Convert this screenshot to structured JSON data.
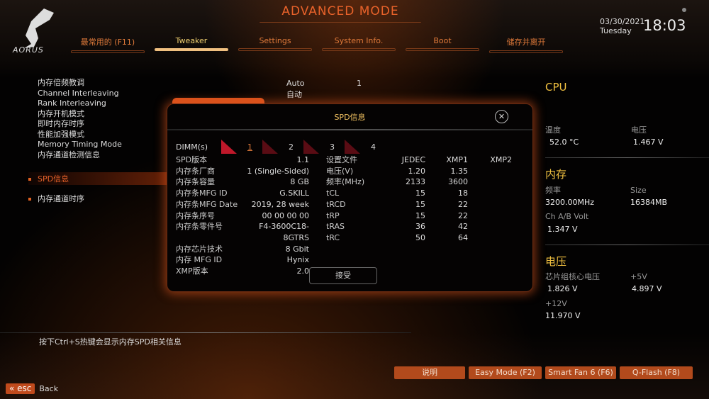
{
  "header": {
    "title": "ADVANCED MODE",
    "logo": "AORUS",
    "date": "03/30/2021",
    "day": "Tuesday",
    "time": "18:03"
  },
  "tabs": [
    {
      "label": "最常用的 (F11)"
    },
    {
      "label": "Tweaker",
      "active": true
    },
    {
      "label": "Settings"
    },
    {
      "label": "System Info."
    },
    {
      "label": "Boot"
    },
    {
      "label": "储存并离开"
    }
  ],
  "menu": {
    "items": [
      "内存倍频教调",
      "Channel Interleaving",
      "Rank Interleaving",
      "内存开机模式",
      "即时内存时序",
      "性能加强模式",
      "Memory Timing Mode",
      "内存通道检测信息"
    ],
    "values": [
      "Auto",
      "1",
      "自动"
    ],
    "sub_items": [
      {
        "label": "SPD信息",
        "selected": true
      },
      {
        "label": "内存通道时序"
      }
    ]
  },
  "modal": {
    "title": "SPD信息",
    "accept_label": "接受",
    "dimm_label": "DIMM(s)",
    "dimms": [
      "1",
      "2",
      "3",
      "4"
    ],
    "selected_dimm": "1",
    "info": [
      [
        "SPD版本",
        "1.1"
      ],
      [
        "内存条厂商",
        "1 (Single-Sided)"
      ],
      [
        "内存条容量",
        "8 GB"
      ],
      [
        "内存条MFG ID",
        "G.SKILL"
      ],
      [
        "内存条MFG Date",
        "2019, 28 week"
      ],
      [
        "内存条序号",
        "00 00 00 00"
      ],
      [
        "内存条零件号",
        "F4-3600C18-8GTRS"
      ],
      [
        "内存芯片技术",
        "8 Gbit"
      ],
      [
        "内存 MFG ID",
        "Hynix"
      ],
      [
        "XMP版本",
        "2.0"
      ]
    ],
    "timing_headers": [
      "设置文件",
      "JEDEC",
      "XMP1",
      "XMP2"
    ],
    "timings": [
      [
        "电压(V)",
        "1.20",
        "1.35",
        ""
      ],
      [
        "频率(MHz)",
        "2133",
        "3600",
        ""
      ],
      [
        "tCL",
        "15",
        "18",
        ""
      ],
      [
        "tRCD",
        "15",
        "22",
        ""
      ],
      [
        "tRP",
        "15",
        "22",
        ""
      ],
      [
        "tRAS",
        "36",
        "42",
        ""
      ],
      [
        "tRC",
        "50",
        "64",
        ""
      ]
    ]
  },
  "right_panel": {
    "cpu": {
      "title": "CPU",
      "temp_label": "温度",
      "temp": "52.0 °C",
      "volt_label": "电压",
      "volt": "1.467 V"
    },
    "memory": {
      "title": "内存",
      "freq_label": "频率",
      "freq": "3200.00MHz",
      "size_label": "Size",
      "size": "16384MB",
      "volt_label": "Ch A/B Volt",
      "volt": "1.347 V"
    },
    "voltage": {
      "title": "电压",
      "chipset_label": "芯片组核心电压",
      "chipset": "1.826 V",
      "v5_label": "+5V",
      "v5": "4.897 V",
      "v12_label": "+12V",
      "v12": "11.970 V"
    }
  },
  "footer": {
    "hint": "按下Ctrl+S热键会显示内存SPD相关信息",
    "buttons": [
      "说明",
      "Easy Mode (F2)",
      "Smart Fan 6 (F6)",
      "Q-Flash (F8)"
    ],
    "esc_key": "esc",
    "esc_label": "Back"
  },
  "colors": {
    "accent": "#e8622a",
    "title_gold": "#f0c040",
    "button": "#b24a1c"
  }
}
